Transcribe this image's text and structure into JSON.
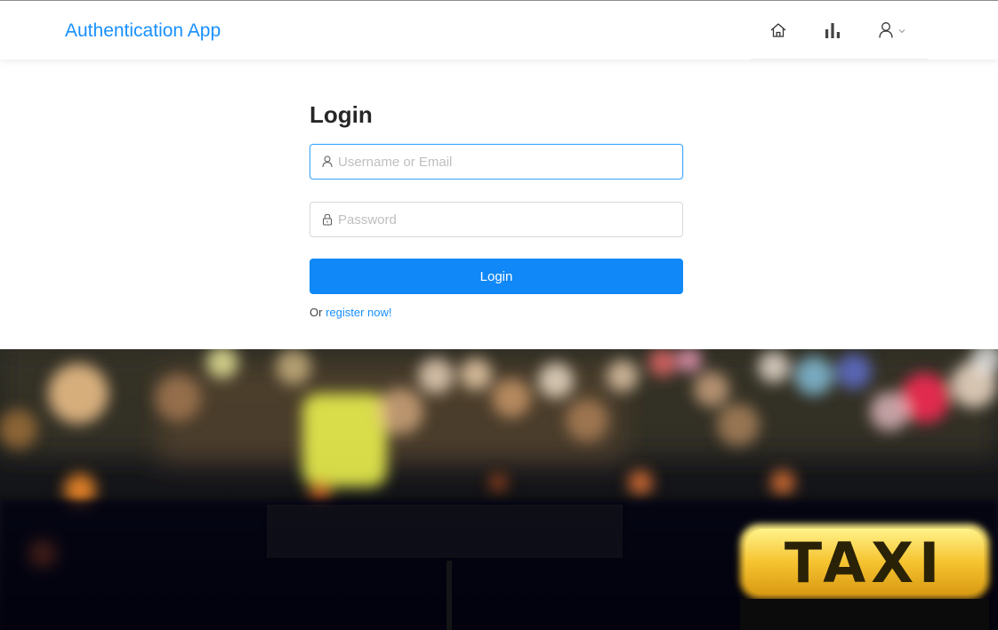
{
  "header": {
    "brand": "Authentication App",
    "nav": [
      {
        "icon": "home-icon"
      },
      {
        "icon": "bar-chart-icon"
      },
      {
        "icon": "user-icon",
        "dropdown_icon": "chevron-down-icon"
      }
    ]
  },
  "login": {
    "title": "Login",
    "username_placeholder": "Username or Email",
    "username_value": "",
    "password_placeholder": "Password",
    "password_value": "",
    "submit_label": "Login",
    "register_prefix": "Or ",
    "register_link": "register now!"
  },
  "background": {
    "taxi_sign": "TAXI"
  },
  "colors": {
    "brand": "#1890ff",
    "primary_button": "#1088f7",
    "focus_border": "#40a9ff"
  }
}
